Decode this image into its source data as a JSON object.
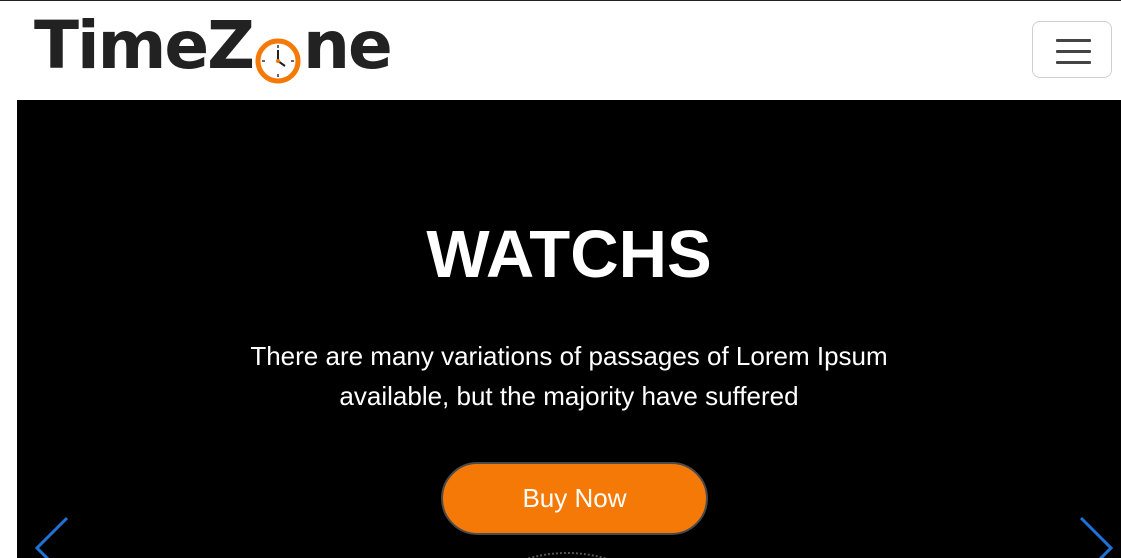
{
  "brand": {
    "name_before": "TimeZ",
    "name_after": "ne",
    "clock_icon": "clock-icon",
    "accent_color": "#f57906"
  },
  "navbar": {
    "menu_icon": "hamburger-menu-icon"
  },
  "hero": {
    "title": "WATCHS",
    "text": "There are many variations of passages of Lorem Ipsum available, but the majority have suffered",
    "button_label": "Buy Now",
    "button_color": "#f57906",
    "prev_icon": "chevron-left-icon",
    "next_icon": "chevron-right-icon",
    "arrow_color": "#1e73d8"
  }
}
